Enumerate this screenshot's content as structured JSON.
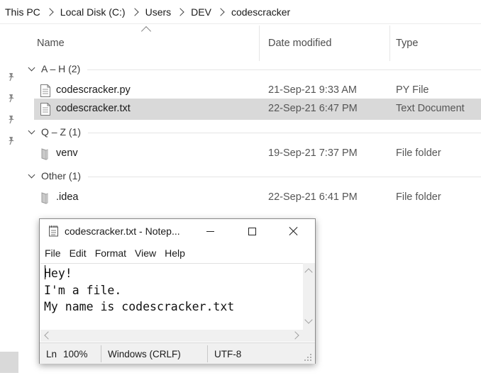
{
  "breadcrumb": [
    "This PC",
    "Local Disk (C:)",
    "Users",
    "DEV",
    "codescracker"
  ],
  "columns": {
    "name": "Name",
    "date": "Date modified",
    "type": "Type"
  },
  "groups": [
    {
      "label": "A – H (2)"
    },
    {
      "label": "Q – Z (1)"
    },
    {
      "label": "Other (1)"
    }
  ],
  "files": [
    {
      "name": "codescracker.py",
      "date": "21-Sep-21 9:33 AM",
      "type": "PY File",
      "icon": "python-file-icon"
    },
    {
      "name": "codescracker.txt",
      "date": "22-Sep-21 6:47 PM",
      "type": "Text Document",
      "icon": "text-file-icon",
      "selected": true
    },
    {
      "name": "venv",
      "date": "19-Sep-21 7:37 PM",
      "type": "File folder",
      "icon": "folder-icon"
    },
    {
      "name": ".idea",
      "date": "22-Sep-21 6:41 PM",
      "type": "File folder",
      "icon": "folder-icon"
    }
  ],
  "notepad": {
    "title": "codescracker.txt - Notep...",
    "menu": [
      "File",
      "Edit",
      "Format",
      "View",
      "Help"
    ],
    "content": "Hey!\nI'm a file.\nMy name is codescracker.txt",
    "status": {
      "position": "Ln",
      "zoom": "100%",
      "line_ending": "Windows (CRLF)",
      "encoding": "UTF-8"
    }
  },
  "colors": {
    "selection": "#d9d9d9",
    "status_bar": "#f0f0f0"
  }
}
